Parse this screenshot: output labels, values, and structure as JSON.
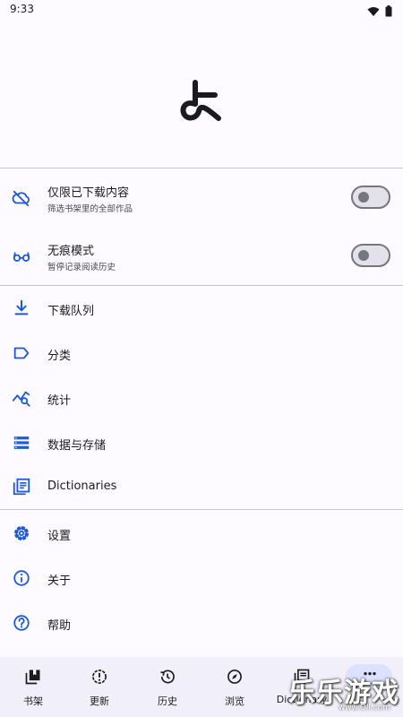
{
  "status_bar": {
    "time": "9:33",
    "icons": [
      "wifi-icon",
      "battery-icon"
    ]
  },
  "logo": {
    "name": "app-logo"
  },
  "toggles": [
    {
      "title": "仅限已下载内容",
      "subtitle": "筛选书架里的全部作品",
      "icon": "cloud-off-icon",
      "on": false
    },
    {
      "title": "无痕模式",
      "subtitle": "暂停记录阅读历史",
      "icon": "glasses-icon",
      "on": false
    }
  ],
  "menu": [
    {
      "label": "下载队列",
      "icon": "download-icon"
    },
    {
      "label": "分类",
      "icon": "label-icon"
    },
    {
      "label": "统计",
      "icon": "stats-icon"
    },
    {
      "label": "数据与存储",
      "icon": "storage-icon"
    },
    {
      "label": "Dictionaries",
      "icon": "dictionary-icon"
    }
  ],
  "menu2": [
    {
      "label": "设置",
      "icon": "settings-icon"
    },
    {
      "label": "关于",
      "icon": "info-icon"
    },
    {
      "label": "帮助",
      "icon": "help-icon"
    }
  ],
  "bottom_nav": [
    {
      "label": "书架",
      "icon": "library-icon"
    },
    {
      "label": "更新",
      "icon": "updates-icon"
    },
    {
      "label": "历史",
      "icon": "history-icon"
    },
    {
      "label": "浏览",
      "icon": "browse-icon"
    },
    {
      "label": "Dictionary",
      "icon": "dictionary-icon"
    },
    {
      "label": "",
      "icon": "more-icon",
      "selected": true
    }
  ],
  "watermark": {
    "big": "乐乐游戏",
    "small": "www.Oll.com"
  },
  "colors": {
    "accent": "#1e5bd6",
    "background": "#fdfbff",
    "nav_bg": "#f1effa",
    "divider": "#c9c6cf"
  }
}
